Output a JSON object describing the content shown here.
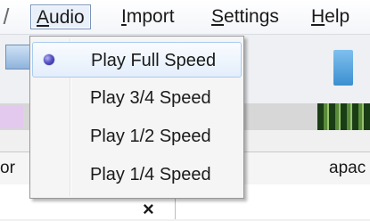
{
  "menubar": {
    "items": [
      {
        "label": "Audio",
        "mnemonic": "A",
        "rest": "udio",
        "active": true
      },
      {
        "label": "Import",
        "mnemonic": "I",
        "rest": "mport",
        "active": false
      },
      {
        "label": "Settings",
        "mnemonic": "S",
        "rest": "ettings",
        "active": false
      },
      {
        "label": "Help",
        "mnemonic": "H",
        "rest": "elp",
        "active": false
      }
    ]
  },
  "dropdown": {
    "items": [
      {
        "label": "Play Full Speed",
        "selected": true
      },
      {
        "label": "Play 3/4 Speed",
        "selected": false
      },
      {
        "label": "Play 1/2 Speed",
        "selected": false
      },
      {
        "label": "Play 1/4 Speed",
        "selected": false
      }
    ],
    "selected_indicator_icon": "radio-dot-icon"
  },
  "background": {
    "left_fragment": "or",
    "right_fragment": "apac",
    "close_glyph": "×"
  },
  "colors": {
    "active_menu_border": "#7a93b8",
    "highlight_border": "#a8cbf0",
    "radio_dot": "#4b46b8"
  }
}
